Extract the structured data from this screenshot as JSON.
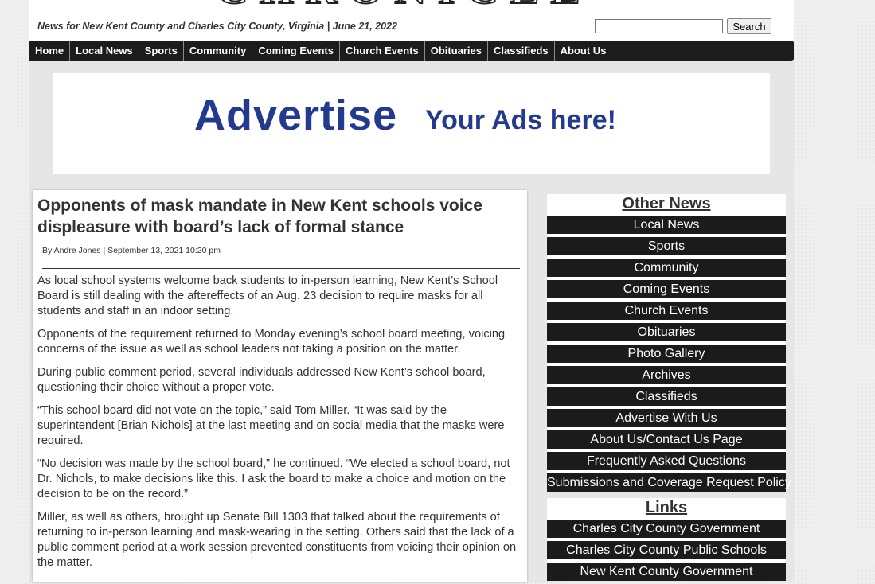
{
  "header": {
    "logo_text": "CHRONICLE",
    "tagline": "News for New Kent County and Charles City County, Virginia | June 21, 2022",
    "search": {
      "value": "",
      "button_label": "Search"
    }
  },
  "nav": {
    "items": [
      "Home",
      "Local News",
      "Sports",
      "Community",
      "Coming Events",
      "Church Events",
      "Obituaries",
      "Classifieds",
      "About Us"
    ]
  },
  "ad": {
    "word1": "Advertise",
    "word2": "Your Ads here!",
    "color": "#233a8f"
  },
  "article": {
    "title": "Opponents of mask mandate in New Kent schools voice displeasure with board’s lack of formal stance",
    "byline": "By Andre Jones | September 13, 2021 10:20 pm",
    "paragraphs": [
      "As local school systems welcome back students to in-person learning, New Kent’s School Board is still dealing with the aftereffects of an Aug. 23 decision to require masks for all students and staff in an indoor setting.",
      "Opponents of the requirement returned to Monday evening’s school board meeting, voicing concerns of the issue as well as school leaders not taking a position on the matter.",
      "During public comment period, several individuals addressed New Kent’s school board, questioning their choice without a proper vote.",
      "“This school board did not vote on the topic,” said Tom Miller. “It was said by the superintendent [Brian Nichols] at the last meeting and on social media that the masks were required.",
      "“No decision was made by the school board,” he continued. “We elected a school board, not Dr. Nichols, to make decisions like this. I ask the board to make a choice and motion on the decision to be on the record.”",
      "Miller, as well as others, brought up Senate Bill 1303 that talked about the requirements of returning to in-person learning and mask-wearing in the setting. Others said that the lack of a public comment period at a work session prevented constituents from voicing their opinion on the matter."
    ]
  },
  "sidebar": {
    "other_news": {
      "heading": "Other News",
      "items": [
        "Local News",
        "Sports",
        "Community",
        "Coming Events",
        "Church Events",
        "Obituaries",
        "Photo Gallery",
        "Archives",
        "Classifieds",
        "Advertise With Us",
        "About Us/Contact Us Page",
        "Frequently Asked Questions",
        "Submissions and Coverage Request Policy"
      ]
    },
    "links": {
      "heading": "Links",
      "items": [
        "Charles City County Government",
        "Charles City County Public Schools",
        "New Kent County Government"
      ]
    }
  }
}
